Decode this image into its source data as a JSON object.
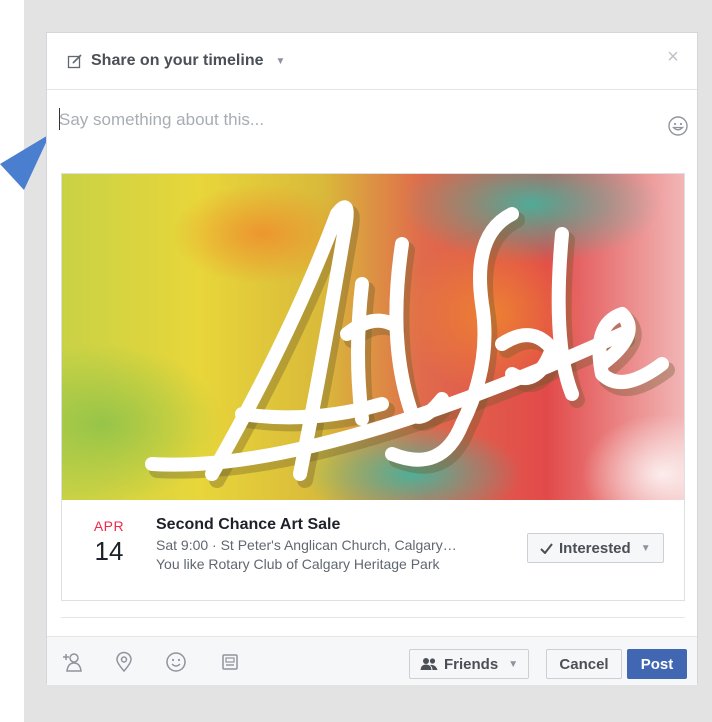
{
  "dialog": {
    "title": "Share on your timeline",
    "composer_placeholder": "Say something about this..."
  },
  "event": {
    "image_text": "Art Sale",
    "month": "APR",
    "day": "14",
    "title": "Second Chance Art Sale",
    "details": "Sat 9:00 · St Peter's Anglican Church, Calgary…",
    "social": "You like Rotary Club of Calgary Heritage Park",
    "interested_label": "Interested"
  },
  "footer": {
    "icons": [
      "tag-friends-icon",
      "location-pin-icon",
      "feeling-icon",
      "sticker-icon"
    ],
    "audience_label": "Friends",
    "cancel_label": "Cancel",
    "post_label": "Post"
  },
  "colors": {
    "accent": "#4267b2",
    "pointer_arrow": "#4a7fcf",
    "month_red": "#f02849",
    "backdrop": "#e3e3e4"
  }
}
